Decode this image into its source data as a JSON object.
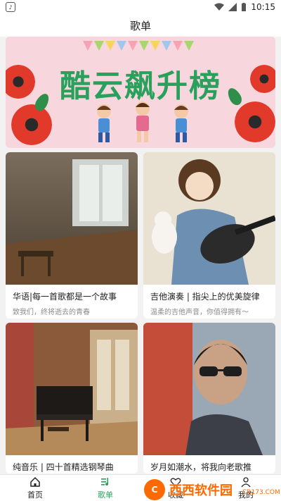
{
  "status_bar": {
    "time": "10:15"
  },
  "header": {
    "title": "歌单"
  },
  "banner": {
    "title": "酷云飙升榜",
    "colors": {
      "background": "#f8d6dd",
      "title": "#2aa05d",
      "flower": "#e23a2a"
    }
  },
  "playlists": [
    {
      "title": "华语|每一首歌都是一个故事",
      "subtitle": "致我们，终将逝去的青春",
      "image": "classroom-photo"
    },
    {
      "title": "吉他演奏 | 指尖上的优美旋律",
      "subtitle": "温柔的吉他声音，你值得拥有～",
      "image": "guitar-boy-illustration"
    },
    {
      "title": "纯音乐 | 四十首精选钢琴曲",
      "subtitle": "",
      "image": "piano-room-photo"
    },
    {
      "title": "岁月如潮水，将我向老歌推",
      "subtitle": "",
      "image": "man-sunglasses-photo"
    }
  ],
  "bottom_nav": {
    "items": [
      {
        "label": "首页",
        "icon": "home-icon",
        "active": false
      },
      {
        "label": "歌单",
        "icon": "music-list-icon",
        "active": true
      },
      {
        "label": "收藏",
        "icon": "favorite-icon",
        "active": false
      },
      {
        "label": "我的",
        "icon": "profile-icon",
        "active": false
      }
    ],
    "active_color": "#2aa05d"
  },
  "watermark": {
    "text": "西西软件园",
    "url": "CR173.COM"
  }
}
